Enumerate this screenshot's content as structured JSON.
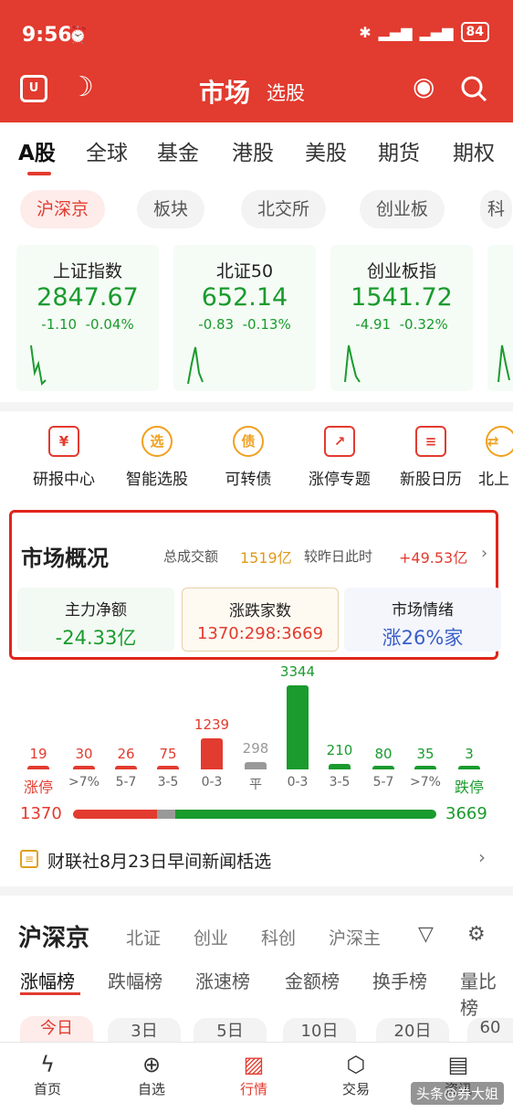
{
  "status": {
    "time": "9:56",
    "battery": "84"
  },
  "header": {
    "title": "市场",
    "subtitle": "选股"
  },
  "market_tabs": [
    "A股",
    "全球",
    "基金",
    "港股",
    "美股",
    "期货",
    "期权"
  ],
  "sub_tabs": [
    "沪深京",
    "板块",
    "北交所",
    "创业板",
    "科"
  ],
  "indices": [
    {
      "name": "上证指数",
      "value": "2847.67",
      "chg": "-1.10",
      "pct": "-0.04%"
    },
    {
      "name": "北证50",
      "value": "652.14",
      "chg": "-0.83",
      "pct": "-0.13%"
    },
    {
      "name": "创业板指",
      "value": "1541.72",
      "chg": "-4.91",
      "pct": "-0.32%"
    }
  ],
  "functions": [
    "研报中心",
    "智能选股",
    "可转债",
    "涨停专题",
    "新股日历",
    "北上"
  ],
  "function_icons": [
    "report-icon",
    "smart-pick-icon",
    "convertible-bond-icon",
    "limit-up-icon",
    "ipo-calendar-icon",
    "northbound-icon"
  ],
  "overview": {
    "title": "市场概况",
    "turnover_label": "总成交额",
    "turnover": "1519亿",
    "compare_label": "较昨日此时",
    "compare": "+49.53亿",
    "cards": [
      {
        "label": "主力净额",
        "value": "-24.33亿",
        "color": "#1a9b2e"
      },
      {
        "label": "涨跌家数",
        "value": "1370:298:3669",
        "color": "#e23b2f"
      },
      {
        "label": "市场情绪",
        "value": "涨26%家",
        "color": "#3a5ec8"
      }
    ]
  },
  "distribution": {
    "labels": [
      "涨停",
      ">7%",
      "5-7",
      "3-5",
      "0-3",
      "平",
      "0-3",
      "3-5",
      "5-7",
      ">7%",
      "跌停"
    ],
    "values": [
      "19",
      "30",
      "26",
      "75",
      "1239",
      "298",
      "3344",
      "210",
      "80",
      "35",
      "3"
    ],
    "counts": [
      19,
      30,
      26,
      75,
      1239,
      298,
      3344,
      210,
      80,
      35,
      3
    ],
    "colors": [
      "#e23b2f",
      "#e23b2f",
      "#e23b2f",
      "#e23b2f",
      "#e23b2f",
      "#999999",
      "#1a9b2e",
      "#1a9b2e",
      "#1a9b2e",
      "#1a9b2e",
      "#1a9b2e"
    ],
    "up": "1370",
    "down": "3669"
  },
  "news": {
    "text": "财联社8月23日早间新闻栝选"
  },
  "section": {
    "title": "沪深京",
    "tabs": [
      "北证",
      "创业",
      "科创",
      "沪深主"
    ]
  },
  "rank_tabs": [
    "涨幅榜",
    "跌幅榜",
    "涨速榜",
    "金额榜",
    "换手榜",
    "量比榜"
  ],
  "period_tabs": [
    "今日",
    "3日",
    "5日",
    "10日",
    "20日",
    "60"
  ],
  "nav": [
    "首页",
    "自选",
    "行情",
    "交易",
    "资讯"
  ],
  "nav_icons": [
    "home-icon",
    "plus-icon",
    "chart-icon",
    "exchange-icon",
    "news-icon"
  ],
  "watermark": "头条@券大姐"
}
